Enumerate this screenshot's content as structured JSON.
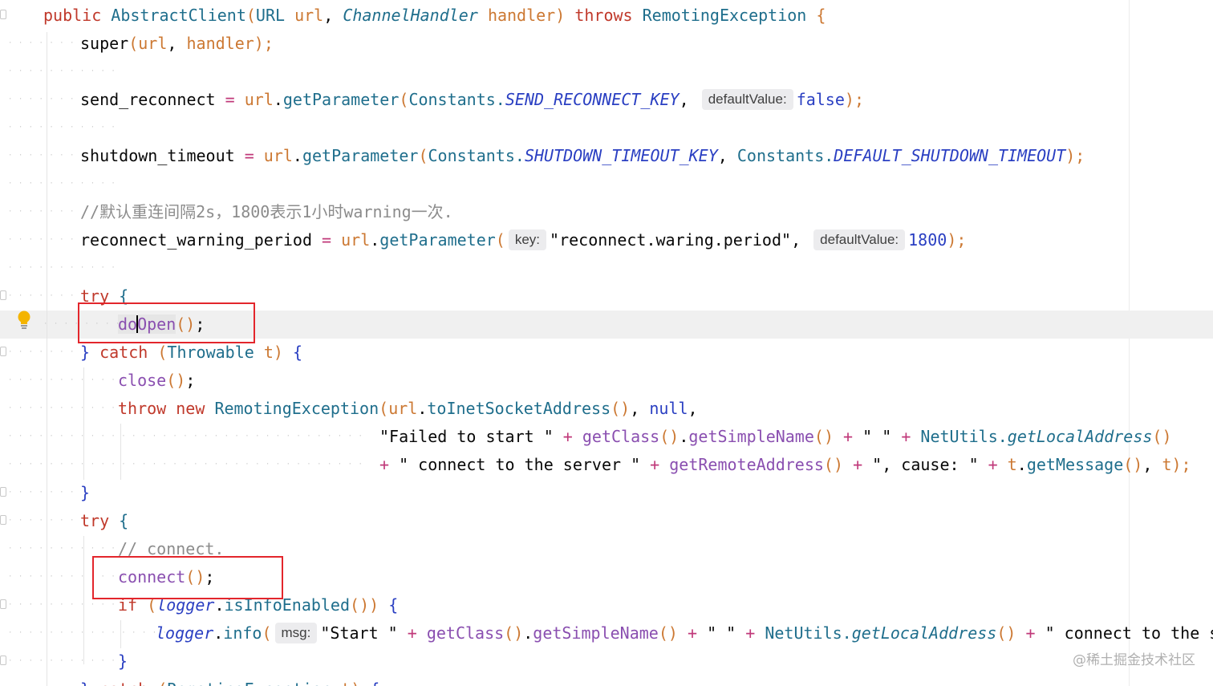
{
  "editor": {
    "watermark": "@稀土掘金技术社区",
    "lines": {
      "l1": {
        "kw_public": "public",
        "cls": "AbstractClient",
        "p1": "(",
        "type_url": "URL",
        "arg_url": "url",
        ",": "",
        "type_handler": "ChannelHandler",
        "arg_handler": "handler",
        ")": "",
        "throws": "throws",
        "exc": "RemotingException",
        "brace": "{"
      },
      "l2": {
        "super": "super",
        "open": "(",
        "url": "url",
        "comma": ",",
        "handler": "handler",
        "close": ");"
      },
      "l3": {
        "name": "send_reconnect",
        "eq": "=",
        "url": "url",
        "dot": ".",
        "method": "getParameter",
        "open": "(",
        "cls": "Constants.",
        "const": "SEND_RECONNECT_KEY",
        "comma": ",",
        "hint": "defaultValue:",
        "val": "false",
        "close": ");"
      },
      "l4": {
        "name": "shutdown_timeout",
        "eq": "=",
        "url": "url",
        "dot": ".",
        "method": "getParameter",
        "open": "(",
        "cls": "Constants.",
        "const": "SHUTDOWN_TIMEOUT_KEY",
        "comma": ",",
        "cls2": "Constants.",
        "const2": "DEFAULT_SHUTDOWN_TIMEOUT",
        "close": ");"
      },
      "l5": {
        "comment": "//默认重连间隔2s，1800表示1小时warning一次."
      },
      "l6": {
        "name": "reconnect_warning_period",
        "eq": "=",
        "url": "url",
        "dot": ".",
        "method": "getParameter",
        "open": "(",
        "hint_key": "key:",
        "str": "\"reconnect.waring.period\"",
        "comma": ",",
        "hint_dv": "defaultValue:",
        "num": "1800",
        "close": ");"
      },
      "l7": {
        "try": "try",
        "brace": "{"
      },
      "l8": {
        "do": "do",
        "open_rest": "Open",
        "parens": "()",
        "semi": ";"
      },
      "l9": {
        "brace": "}",
        "catch": "catch",
        "open": "(",
        "type": "Throwable",
        "var": "t",
        ")": ")",
        "brace2": "{"
      },
      "l10": {
        "close": "close",
        "parens": "()",
        "semi": ";"
      },
      "l11": {
        "throw": "throw",
        "new": "new",
        "exc": "RemotingException",
        "open": "(",
        "url": "url",
        "dot": ".",
        "method": "toInetSocketAddress",
        "parens": "()",
        "comma": ",",
        "null": "null",
        "comma2": ","
      },
      "l12": {
        "s1": "\"Failed to start \"",
        "plus1": "+",
        "gc": "getClass",
        "p1": "()",
        "dot": ".",
        "gsn": "getSimpleName",
        "p2": "()",
        "plus2": "+",
        "s2": "\" \"",
        "plus3": "+",
        "nu": "NetUtils.",
        "gla": "getLocalAddress",
        "p3": "()"
      },
      "l13": {
        "plus0": "+",
        "s1": "\" connect to the server \"",
        "plus1": "+",
        "gra": "getRemoteAddress",
        "p1": "()",
        "plus2": "+",
        "s2": "\", cause: \"",
        "plus3": "+",
        "t": "t",
        "dot": ".",
        "gm": "getMessage",
        "p2": "()",
        "comma": ",",
        "t2": "t",
        "close": ");"
      },
      "l14": {
        "brace": "}"
      },
      "l15": {
        "try": "try",
        "brace": "{"
      },
      "l16": {
        "comment": "// connect."
      },
      "l17": {
        "connect": "connect",
        "parens": "()",
        "semi": ";"
      },
      "l18": {
        "if": "if",
        "open": "(",
        "logger": "logger",
        "dot": ".",
        "method": "isInfoEnabled",
        "parens": "())",
        "brace": "{"
      },
      "l19": {
        "logger": "logger",
        "dot": ".",
        "info": "info",
        "open": "(",
        "hint": "msg:",
        "s1": "\"Start \"",
        "plus1": "+",
        "gc": "getClass",
        "p1": "()",
        "dot2": ".",
        "gsn": "getSimpleName",
        "p2": "()",
        "plus2": "+",
        "s2": "\" \"",
        "plus3": "+",
        "nu": "NetUtils.",
        "gla": "getLocalAddress",
        "p3": "()",
        "plus4": "+",
        "s3": "\" connect to the serv"
      },
      "l20": {
        "brace": "}"
      },
      "l21": {
        "brace": "}",
        "catch": "catch",
        "open": "(",
        "type": "RemotingException",
        "var": "t",
        ")": ")",
        "brace2": "{"
      }
    }
  }
}
